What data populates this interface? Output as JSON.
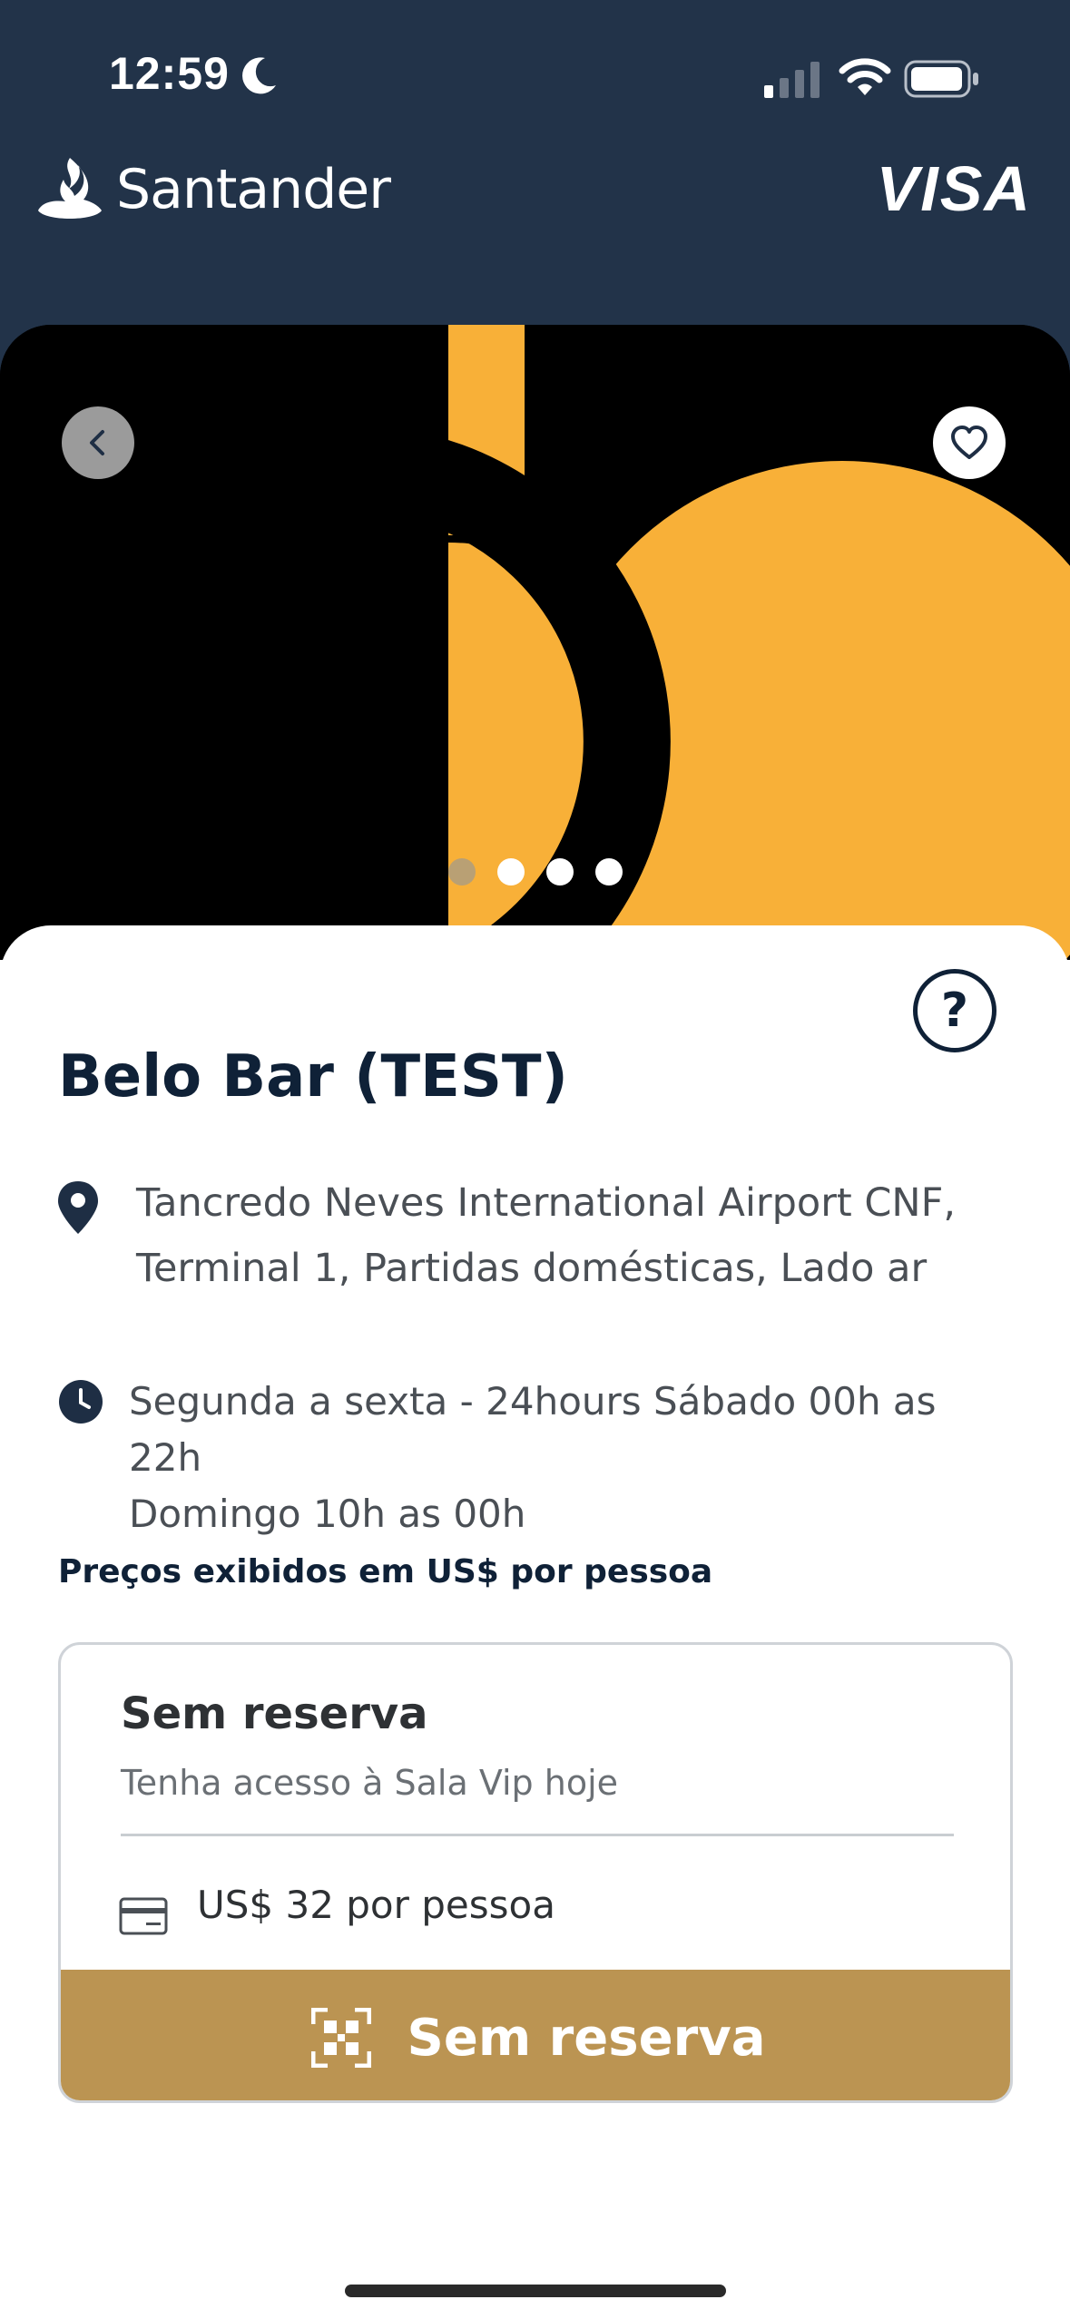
{
  "status_bar": {
    "time": "12:59"
  },
  "header": {
    "brand": "Santander",
    "card_network": "VISA"
  },
  "hero": {
    "carousel": {
      "total": 4,
      "active": 0
    }
  },
  "lounge": {
    "title": "Belo Bar (TEST)",
    "location_line1": "Tancredo Neves International Airport CNF,",
    "location_line2": "Terminal 1, Partidas domésticas, Lado ar",
    "hours_line1": "Segunda a sexta - 24hours Sábado 00h as 22h",
    "hours_line2": "Domingo 10h as 00h",
    "prices_note": "Preços exibidos em US$ por pessoa"
  },
  "offer": {
    "title": "Sem reserva",
    "subtitle": "Tenha acesso à Sala Vip hoje",
    "price": "US$ 32 por pessoa",
    "button_label": "Sem reserva"
  },
  "help": {
    "label": "?"
  },
  "colors": {
    "header_bg": "#223349",
    "accent_orange": "#f8b038",
    "button_gold": "#bb9452",
    "title_navy": "#0f2137"
  },
  "icons": [
    "moon-icon",
    "signal-icon",
    "wifi-icon",
    "battery-icon",
    "flame-icon",
    "back-icon",
    "heart-icon",
    "help-icon",
    "location-pin-icon",
    "clock-icon",
    "credit-card-icon",
    "qr-scan-icon"
  ]
}
